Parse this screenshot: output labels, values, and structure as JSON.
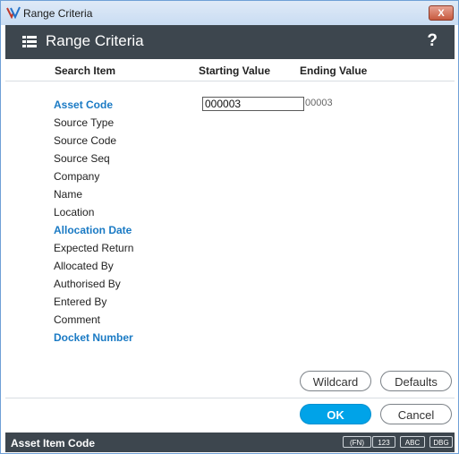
{
  "window": {
    "title": "Range Criteria",
    "close_label": "X"
  },
  "header": {
    "title": "Range Criteria",
    "help_label": "?"
  },
  "columns": {
    "search_item": "Search Item",
    "starting_value": "Starting Value",
    "ending_value": "Ending Value"
  },
  "fields": [
    {
      "label": "Asset Code",
      "highlighted": true
    },
    {
      "label": "Source Type",
      "highlighted": false
    },
    {
      "label": "Source Code",
      "highlighted": false
    },
    {
      "label": "Source Seq",
      "highlighted": false
    },
    {
      "label": "Company",
      "highlighted": false
    },
    {
      "label": "Name",
      "highlighted": false
    },
    {
      "label": "Location",
      "highlighted": false
    },
    {
      "label": "Allocation Date",
      "highlighted": true
    },
    {
      "label": "Expected Return",
      "highlighted": false
    },
    {
      "label": "Allocated By",
      "highlighted": false
    },
    {
      "label": "Authorised By",
      "highlighted": false
    },
    {
      "label": "Entered By",
      "highlighted": false
    },
    {
      "label": "Comment",
      "highlighted": false
    },
    {
      "label": "Docket Number",
      "highlighted": true
    }
  ],
  "asset_code": {
    "starting_value": "000003",
    "ending_value": "00003"
  },
  "buttons": {
    "wildcard": "Wildcard",
    "defaults": "Defaults",
    "ok": "OK",
    "cancel": "Cancel"
  },
  "status": {
    "text": "Asset Item Code",
    "badges": [
      "(FN)",
      "123",
      "ABC",
      "DBG"
    ]
  },
  "colors": {
    "accent": "#00a3e8",
    "highlight_label": "#1a7ac4",
    "header_bg": "#3d464e"
  }
}
